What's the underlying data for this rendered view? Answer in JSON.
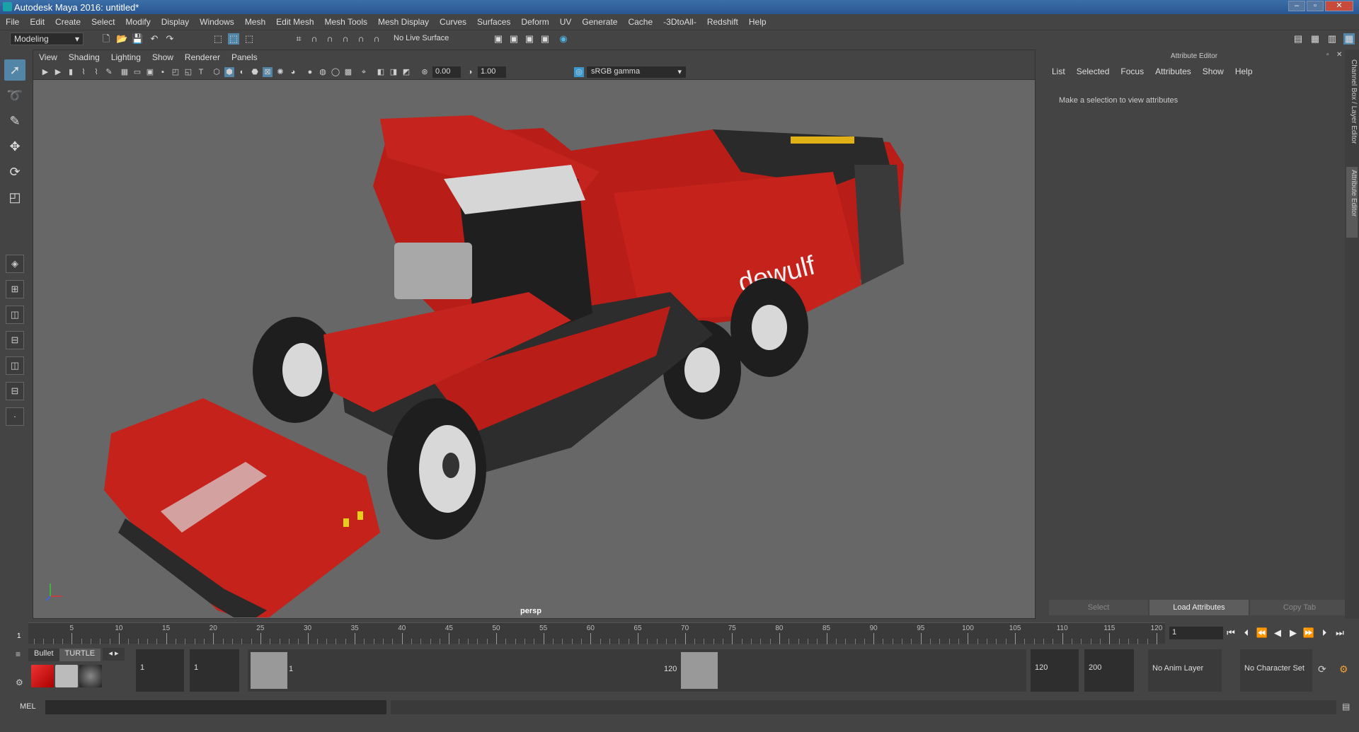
{
  "window": {
    "title": "Autodesk Maya 2016: untitled*"
  },
  "menus": [
    "File",
    "Edit",
    "Create",
    "Select",
    "Modify",
    "Display",
    "Windows",
    "Mesh",
    "Edit Mesh",
    "Mesh Tools",
    "Mesh Display",
    "Curves",
    "Surfaces",
    "Deform",
    "UV",
    "Generate",
    "Cache",
    "-3DtoAll-",
    "Redshift",
    "Help"
  ],
  "statusline": {
    "mode": "Modeling",
    "live_surface": "No Live Surface"
  },
  "viewport": {
    "menus": [
      "View",
      "Shading",
      "Lighting",
      "Show",
      "Renderer",
      "Panels"
    ],
    "exposure": "0.00",
    "gamma_value": "1.00",
    "color_space": "sRGB gamma",
    "camera": "persp",
    "model_brand": "dewulf"
  },
  "attribute_editor": {
    "title": "Attribute Editor",
    "menus": [
      "List",
      "Selected",
      "Focus",
      "Attributes",
      "Show",
      "Help"
    ],
    "message": "Make a selection to view attributes",
    "buttons": {
      "select": "Select",
      "load": "Load Attributes",
      "copy": "Copy Tab"
    }
  },
  "side_tabs": [
    "Channel Box / Layer Editor",
    "Attribute Editor"
  ],
  "time_slider": {
    "ticks": [
      "5",
      "10",
      "15",
      "20",
      "25",
      "30",
      "35",
      "40",
      "45",
      "50",
      "55",
      "60",
      "65",
      "70",
      "75",
      "80",
      "85",
      "90",
      "95",
      "100",
      "105",
      "110",
      "115",
      "120"
    ],
    "current_marker": "1",
    "current_frame": "1"
  },
  "range": {
    "start_time": "1",
    "playback_start": "1",
    "range_start_label": "1",
    "range_end_label": "120",
    "playback_end": "120",
    "end_time": "200",
    "anim_layer": "No Anim Layer",
    "character_set": "No Character Set"
  },
  "shelf": {
    "tabs": [
      "Bullet",
      "TURTLE"
    ]
  },
  "command_line": {
    "label": "MEL"
  }
}
